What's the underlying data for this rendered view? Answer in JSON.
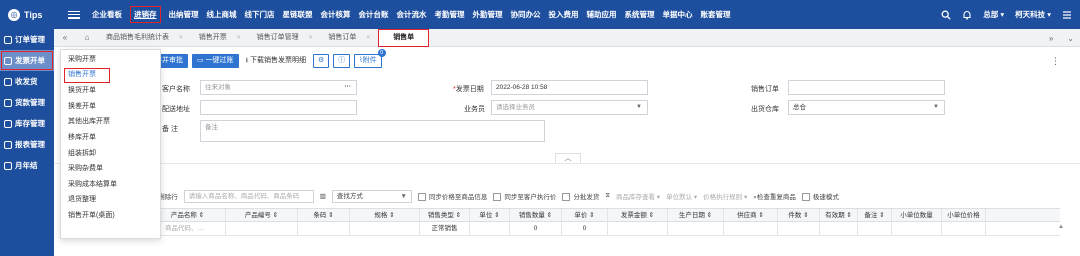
{
  "brand": {
    "logo_glyph": "◎",
    "name": "Tips"
  },
  "topnav": [
    {
      "label": "企业看板"
    },
    {
      "label": "进销存",
      "active": true
    },
    {
      "label": "出纳管理"
    },
    {
      "label": "线上商城"
    },
    {
      "label": "线下门店"
    },
    {
      "label": "星链联盟"
    },
    {
      "label": "会计核算"
    },
    {
      "label": "会计台账"
    },
    {
      "label": "会计流水"
    },
    {
      "label": "考勤管理"
    },
    {
      "label": "外勤管理"
    },
    {
      "label": "协同办公"
    },
    {
      "label": "投入费用"
    },
    {
      "label": "辅助应用"
    },
    {
      "label": "系统管理"
    },
    {
      "label": "单据中心"
    },
    {
      "label": "账套管理"
    }
  ],
  "top_right": {
    "user": "总部 ▾",
    "company": "柯天科技 ▾"
  },
  "sidebar": [
    {
      "label": "订单管理"
    },
    {
      "label": "发票开单",
      "active": true
    },
    {
      "label": "收发货"
    },
    {
      "label": "货款管理"
    },
    {
      "label": "库存管理"
    },
    {
      "label": "报表管理"
    },
    {
      "label": "月年结"
    }
  ],
  "tabs": [
    {
      "label": "商品销售毛利统计表"
    },
    {
      "label": "销售开票"
    },
    {
      "label": "销售订单管理"
    },
    {
      "label": "销售订单"
    },
    {
      "label": "销售单",
      "active": true
    }
  ],
  "toolbar": {
    "save_audit": "存并审批",
    "one_click": "一键过账",
    "download": "下载销售发票明细",
    "attach": "附件",
    "attach_count": "0"
  },
  "form": {
    "customer_label": "客户名称",
    "customer_placeholder": "往来对象",
    "address_label": "配送地址",
    "remark_label": "备    注",
    "remark_placeholder": "备注",
    "date_label": "发票日期",
    "date_value": "2022-06-28 10:58",
    "salesman_label": "业务员",
    "salesman_placeholder": "请选择业务员",
    "sales_order_label": "销售订单",
    "warehouse_label": "出货仓库",
    "warehouse_value": "总仓"
  },
  "grid_toolbar": {
    "delete_row": "删除行",
    "search_placeholder": "请输入商品名称、商品代码、商品条码",
    "search_mode": "查找方式",
    "sync_price": "同步价格至商品信息",
    "sync_customer_price": "同步至客户执行价",
    "batch_ship": "分批发货",
    "stock_view": "商品库存查看",
    "unit_default": "单位默认",
    "price_rule": "价格执行规则",
    "check_dup": "检查重复商品",
    "fast_mode": "极速模式"
  },
  "table": {
    "headers": [
      "产品名称 ⇕",
      "产品编号 ⇕",
      "条码 ⇕",
      "规格 ⇕",
      "销售类型 ⇕",
      "单位 ⇕",
      "销售数量 ⇕",
      "单价 ⇕",
      "发票金额 ⇕",
      "生产日期 ⇕",
      "供应商 ⇕",
      "件数 ⇕",
      "有效期 ⇕",
      "备注 ⇕",
      "小单位数量",
      "小单位价格"
    ],
    "row": [
      "称、商品代码、…",
      "",
      "",
      "",
      "正常销售",
      "",
      "0",
      "0",
      "",
      "",
      "",
      "",
      "",
      "",
      "",
      ""
    ]
  },
  "dropdown": [
    {
      "label": "采购开票"
    },
    {
      "label": "销售开票",
      "active": true
    },
    {
      "label": "换货开单"
    },
    {
      "label": "换差开单"
    },
    {
      "label": "其他出库开票"
    },
    {
      "label": "移库开单"
    },
    {
      "label": "组装拆卸"
    },
    {
      "label": "采购杂费单"
    },
    {
      "label": "采购成本结算单"
    },
    {
      "label": "退货整理"
    },
    {
      "label": "销售开单(桌面)"
    }
  ],
  "colors": {
    "nav_bg": "#1e4f9e",
    "primary": "#2f74d0",
    "highlight_red": "#e0232a"
  }
}
